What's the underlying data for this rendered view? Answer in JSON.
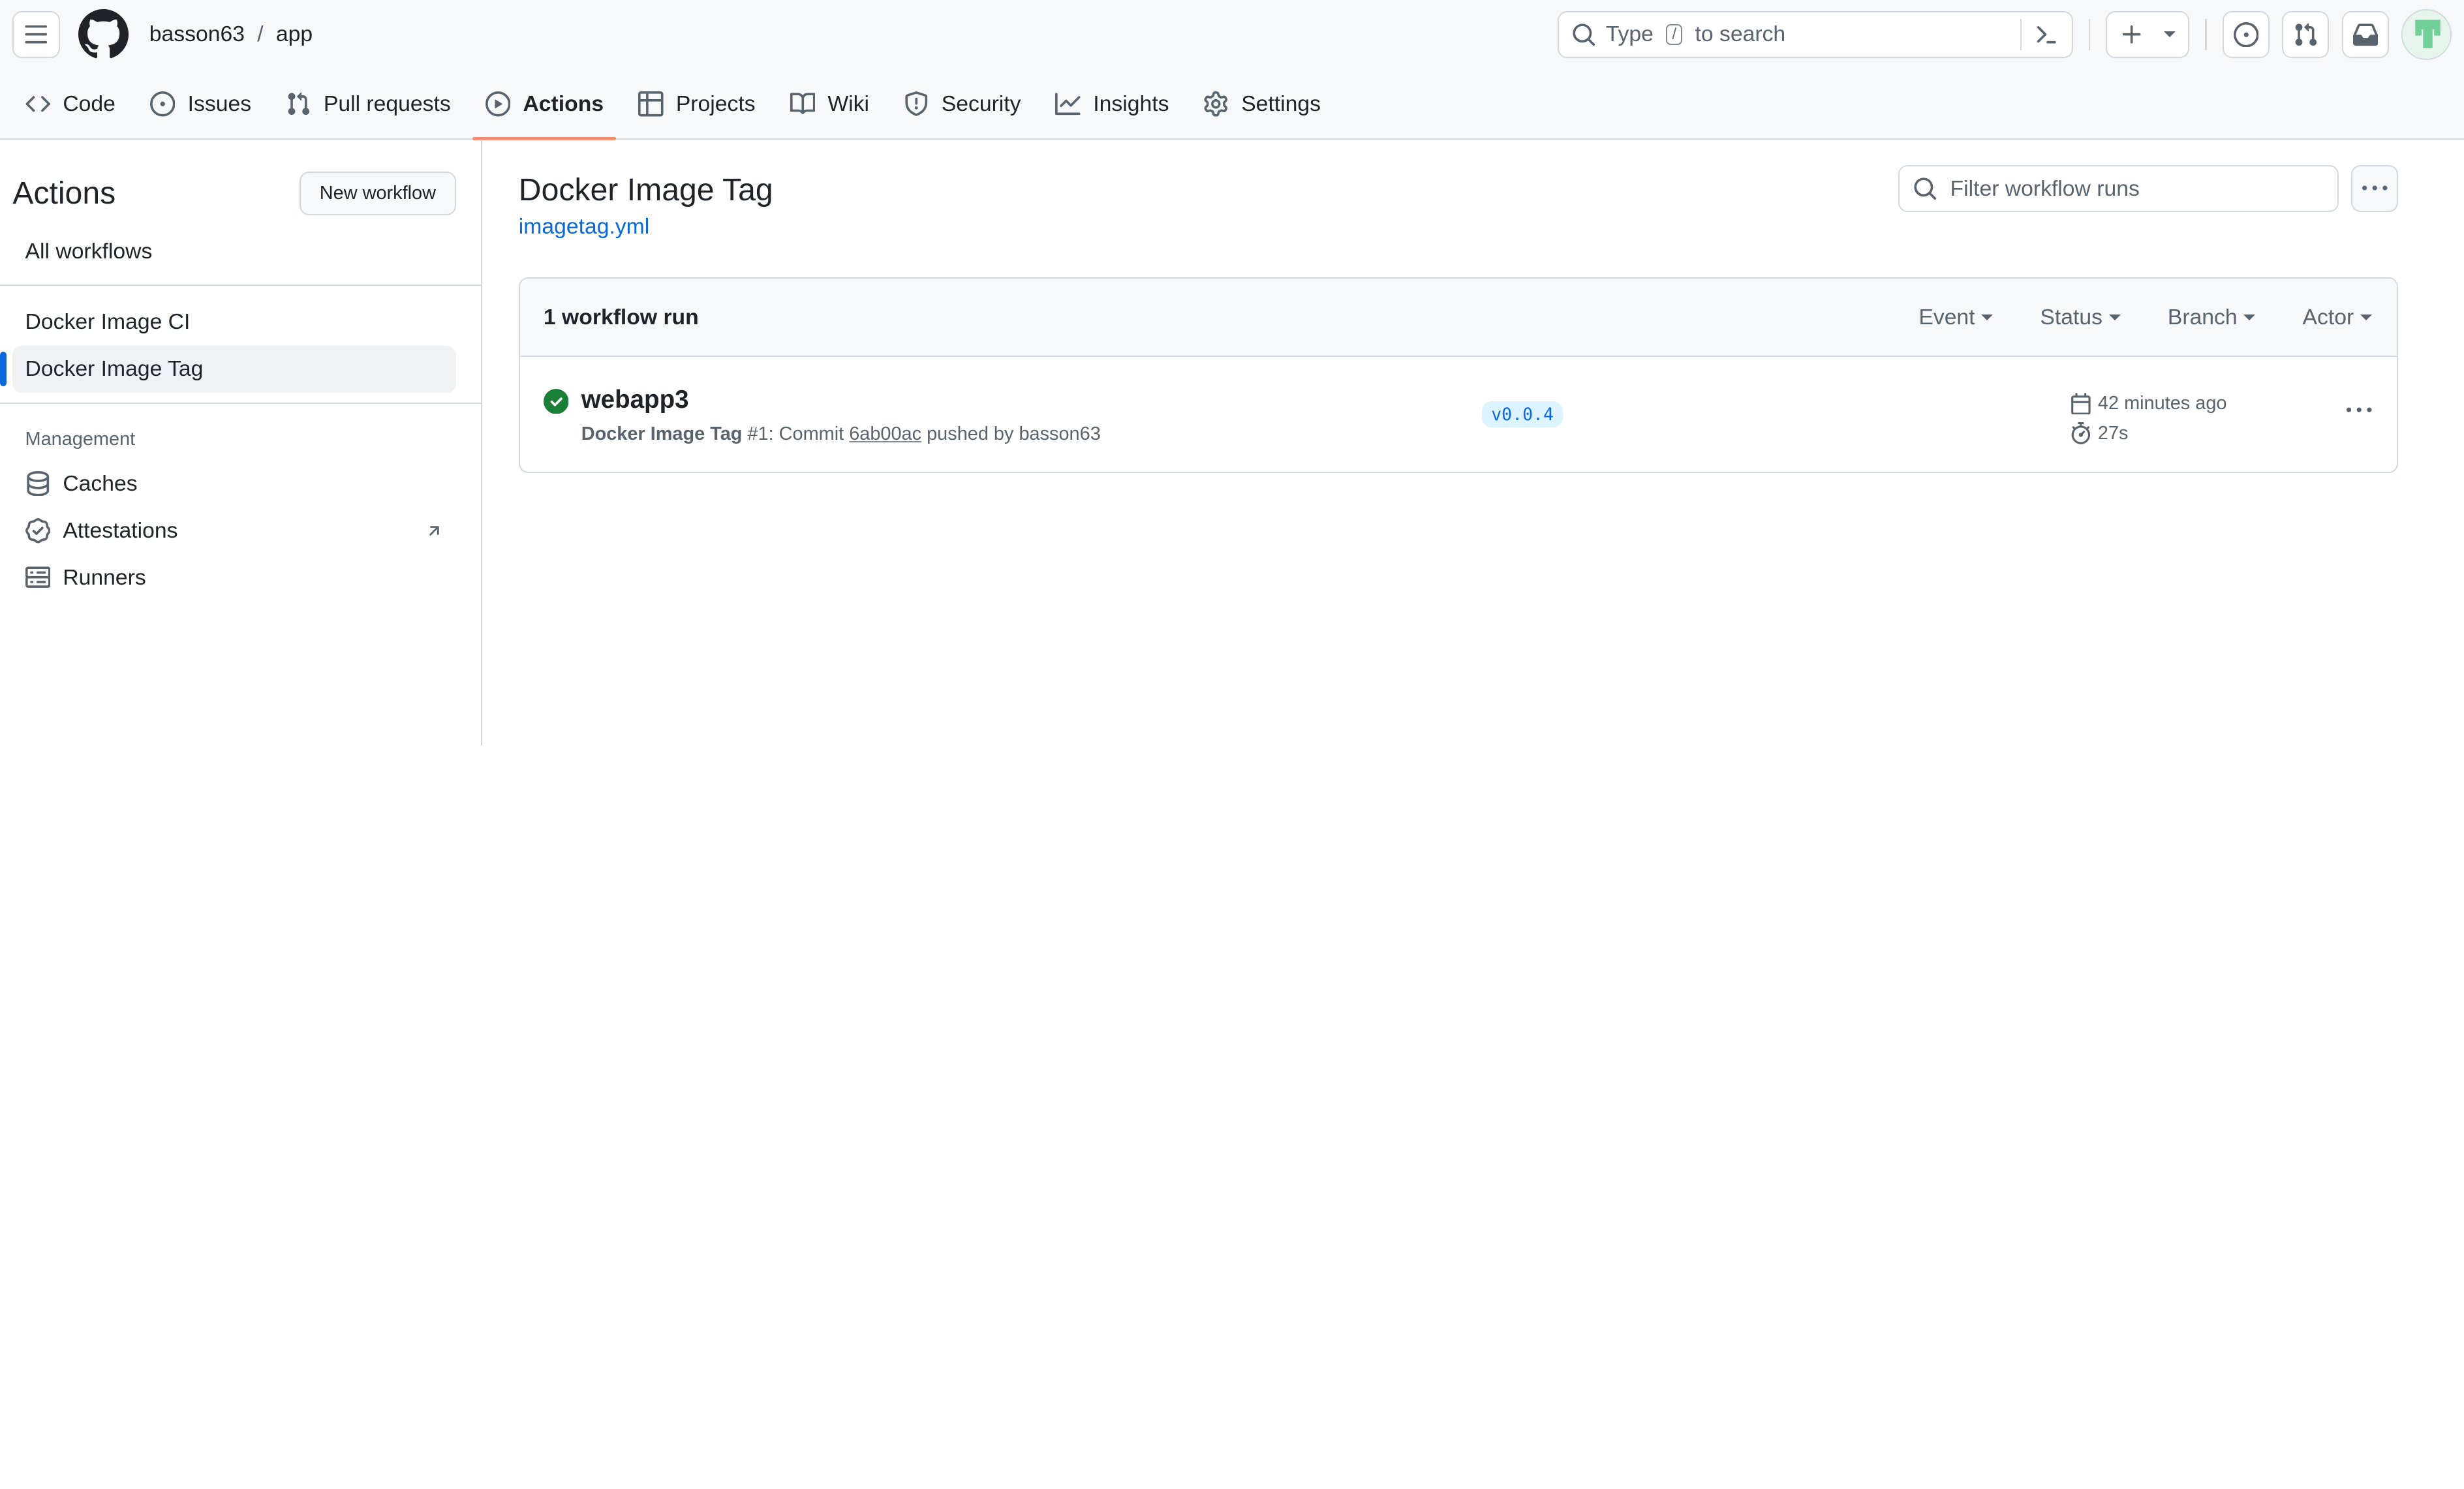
{
  "header": {
    "owner": "basson63",
    "separator": "/",
    "repo": "app",
    "search_prefix": "Type",
    "search_key": "/",
    "search_suffix": "to search"
  },
  "nav": {
    "tabs": [
      {
        "label": "Code"
      },
      {
        "label": "Issues"
      },
      {
        "label": "Pull requests"
      },
      {
        "label": "Actions"
      },
      {
        "label": "Projects"
      },
      {
        "label": "Wiki"
      },
      {
        "label": "Security"
      },
      {
        "label": "Insights"
      },
      {
        "label": "Settings"
      }
    ],
    "active": "Actions"
  },
  "sidebar": {
    "title": "Actions",
    "new_workflow": "New workflow",
    "all_workflows": "All workflows",
    "workflows": [
      {
        "label": "Docker Image CI"
      },
      {
        "label": "Docker Image Tag"
      }
    ],
    "management_label": "Management",
    "management": [
      {
        "label": "Caches"
      },
      {
        "label": "Attestations"
      },
      {
        "label": "Runners"
      }
    ]
  },
  "main": {
    "title": "Docker Image Tag",
    "file": "imagetag.yml",
    "filter_placeholder": "Filter workflow runs",
    "runs_count": "1 workflow run",
    "filters": [
      "Event",
      "Status",
      "Branch",
      "Actor"
    ],
    "run": {
      "title": "webapp3",
      "workflow": "Docker Image Tag",
      "number": "#1: Commit",
      "sha": "6ab00ac",
      "pushed_by": "pushed by basson63",
      "tag": "v0.0.4",
      "time": "42 minutes ago",
      "duration": "27s"
    }
  },
  "colors": {
    "accent": "#0969da",
    "tab_underline": "#fd8c73",
    "success": "#1a7f37"
  }
}
